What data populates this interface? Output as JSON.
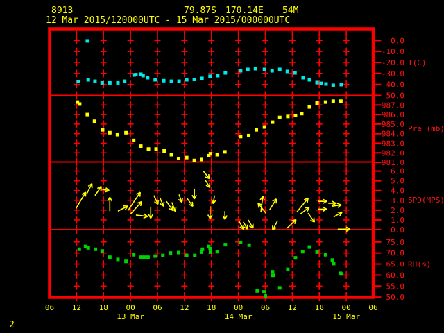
{
  "header": {
    "station_id": "8913",
    "lat": "79.87S",
    "lon": "170.14E",
    "elevation": "54M",
    "period": "12 Mar 2015/120000UTC - 15 Mar 2015/000000UTC"
  },
  "footer": {
    "corner_label": "2"
  },
  "colors": {
    "frame": "#ff0000",
    "axis_text": "#ff1414",
    "time_text": "#ffff00",
    "temp": "#00eaea",
    "pressure": "#ffff00",
    "wind": "#ffff00",
    "rh": "#00d400"
  },
  "x_axis": {
    "hours_span": 72,
    "tick_interval_hours": 6,
    "hour_labels": [
      "06",
      "12",
      "18",
      "00",
      "06",
      "12",
      "18",
      "00",
      "06",
      "12",
      "18",
      "00",
      "06"
    ],
    "date_labels": [
      {
        "label": "13 Mar",
        "col": 3
      },
      {
        "label": "14 Mar",
        "col": 7
      },
      {
        "label": "15 Mar",
        "col": 11
      }
    ]
  },
  "chart_data": [
    {
      "type": "scatter",
      "name": "temperature",
      "unit_label": "T(C)",
      "color_key": "temp",
      "ylim": {
        "top": 10.6,
        "bottom": -50.0
      },
      "yticks": [
        {
          "v": 0,
          "label": "0.0"
        },
        {
          "v": -10,
          "label": "-10.0"
        },
        {
          "v": -20,
          "label": "-20.0"
        },
        {
          "v": -30,
          "label": "-30.0"
        },
        {
          "v": -40,
          "label": "-40.0"
        },
        {
          "v": -50,
          "label": "-50.0"
        }
      ],
      "points": [
        {
          "t": 6.4,
          "v": -37.4
        },
        {
          "t": 8.4,
          "v": -0.4
        },
        {
          "t": 8.6,
          "v": -35.8
        },
        {
          "t": 10.1,
          "v": -37.1
        },
        {
          "t": 11.7,
          "v": -38.6
        },
        {
          "t": 13.4,
          "v": -38.6
        },
        {
          "t": 15.2,
          "v": -38.6
        },
        {
          "t": 16.7,
          "v": -37.1
        },
        {
          "t": 18.8,
          "v": -31.4
        },
        {
          "t": 19.2,
          "v": -31.1
        },
        {
          "t": 20.3,
          "v": -30.7
        },
        {
          "t": 20.8,
          "v": -32.0
        },
        {
          "t": 21.8,
          "v": -33.9
        },
        {
          "t": 23.5,
          "v": -35.8
        },
        {
          "t": 25.4,
          "v": -36.6
        },
        {
          "t": 27.1,
          "v": -37.1
        },
        {
          "t": 28.8,
          "v": -37.1
        },
        {
          "t": 30.5,
          "v": -35.8
        },
        {
          "t": 32.2,
          "v": -35.5
        },
        {
          "t": 33.9,
          "v": -34.5
        },
        {
          "t": 35.7,
          "v": -32.6
        },
        {
          "t": 37.4,
          "v": -32.0
        },
        {
          "t": 39.1,
          "v": -29.5
        },
        {
          "t": 42.5,
          "v": -27.6
        },
        {
          "t": 44.1,
          "v": -26.3
        },
        {
          "t": 45.8,
          "v": -25.7
        },
        {
          "t": 47.8,
          "v": -26.3
        },
        {
          "t": 49.5,
          "v": -27.6
        },
        {
          "t": 51.2,
          "v": -26.3
        },
        {
          "t": 52.9,
          "v": -28.2
        },
        {
          "t": 54.6,
          "v": -29.5
        },
        {
          "t": 56.4,
          "v": -33.9
        },
        {
          "t": 57.8,
          "v": -35.8
        },
        {
          "t": 59.5,
          "v": -38.3
        },
        {
          "t": 60.4,
          "v": -39.0
        },
        {
          "t": 61.5,
          "v": -39.6
        },
        {
          "t": 63.1,
          "v": -40.8
        },
        {
          "t": 64.9,
          "v": -40.2
        }
      ]
    },
    {
      "type": "scatter",
      "name": "pressure",
      "unit_label": "Pre (mb)",
      "color_key": "pressure",
      "ylim": {
        "top": 988.0,
        "bottom": 981.04
      },
      "yticks": [
        {
          "v": 987,
          "label": "987.0"
        },
        {
          "v": 986,
          "label": "986.0"
        },
        {
          "v": 985,
          "label": "985.0"
        },
        {
          "v": 984,
          "label": "984.0"
        },
        {
          "v": 983,
          "label": "983.0"
        },
        {
          "v": 982,
          "label": "982.0"
        },
        {
          "v": 981,
          "label": "981.0"
        }
      ],
      "points": [
        {
          "t": 6.2,
          "v": 987.3
        },
        {
          "t": 6.7,
          "v": 987.1
        },
        {
          "t": 8.4,
          "v": 986.0
        },
        {
          "t": 10.0,
          "v": 985.3
        },
        {
          "t": 11.8,
          "v": 984.4
        },
        {
          "t": 13.4,
          "v": 984.1
        },
        {
          "t": 15.1,
          "v": 983.9
        },
        {
          "t": 17.0,
          "v": 984.1
        },
        {
          "t": 18.7,
          "v": 983.3
        },
        {
          "t": 20.3,
          "v": 982.7
        },
        {
          "t": 22.0,
          "v": 982.4
        },
        {
          "t": 23.7,
          "v": 982.4
        },
        {
          "t": 25.5,
          "v": 982.2
        },
        {
          "t": 27.1,
          "v": 981.8
        },
        {
          "t": 28.7,
          "v": 981.4
        },
        {
          "t": 30.5,
          "v": 981.5
        },
        {
          "t": 32.2,
          "v": 981.2
        },
        {
          "t": 33.8,
          "v": 981.3
        },
        {
          "t": 35.4,
          "v": 981.7
        },
        {
          "t": 35.8,
          "v": 981.9
        },
        {
          "t": 37.3,
          "v": 981.8
        },
        {
          "t": 39.0,
          "v": 982.1
        },
        {
          "t": 42.5,
          "v": 983.7
        },
        {
          "t": 44.3,
          "v": 983.8
        },
        {
          "t": 46.0,
          "v": 984.4
        },
        {
          "t": 47.8,
          "v": 984.7
        },
        {
          "t": 49.6,
          "v": 985.2
        },
        {
          "t": 51.2,
          "v": 985.7
        },
        {
          "t": 53.0,
          "v": 985.8
        },
        {
          "t": 54.7,
          "v": 985.9
        },
        {
          "t": 56.1,
          "v": 986.1
        },
        {
          "t": 57.8,
          "v": 986.8
        },
        {
          "t": 59.5,
          "v": 987.2
        },
        {
          "t": 61.4,
          "v": 987.3
        },
        {
          "t": 63.1,
          "v": 987.4
        },
        {
          "t": 64.8,
          "v": 987.4
        }
      ]
    },
    {
      "type": "wind-vectors",
      "name": "wind-speed-direction",
      "unit_label": "SPD(MPS)",
      "color_key": "wind",
      "ylim": {
        "top": 6.93,
        "bottom": 0
      },
      "yticks": [
        {
          "v": 6,
          "label": "6.0"
        },
        {
          "v": 5,
          "label": "5.0"
        },
        {
          "v": 4,
          "label": "4.0"
        },
        {
          "v": 3,
          "label": "3.0"
        },
        {
          "v": 2,
          "label": "2.0"
        },
        {
          "v": 1,
          "label": "1.0"
        },
        {
          "v": 0,
          "label": "0.0"
        }
      ],
      "arrows": [
        {
          "t": 5.9,
          "spd": 2.2,
          "dir": 31,
          "len": 27
        },
        {
          "t": 8.3,
          "spd": 3.7,
          "dir": 27,
          "len": 16
        },
        {
          "t": 10.1,
          "spd": 3.5,
          "dir": 35,
          "len": 16
        },
        {
          "t": 11.0,
          "spd": 4.2,
          "dir": 101,
          "len": 15
        },
        {
          "t": 13.4,
          "spd": 1.9,
          "dir": 0,
          "len": 20
        },
        {
          "t": 15.2,
          "spd": 1.9,
          "dir": 63,
          "len": 16
        },
        {
          "t": 17.5,
          "spd": 2.0,
          "dir": 34,
          "len": 31
        },
        {
          "t": 18.0,
          "spd": 1.6,
          "dir": 42,
          "len": 24
        },
        {
          "t": 19.2,
          "spd": 1.5,
          "dir": 97,
          "len": 17
        },
        {
          "t": 22.5,
          "spd": 2.3,
          "dir": 180,
          "len": 16
        },
        {
          "t": 23.2,
          "spd": 3.5,
          "dir": 155,
          "len": 14
        },
        {
          "t": 24.5,
          "spd": 3.3,
          "dir": 156,
          "len": 14
        },
        {
          "t": 26.0,
          "spd": 2.9,
          "dir": 145,
          "len": 16
        },
        {
          "t": 27.2,
          "spd": 2.8,
          "dir": 159,
          "len": 14
        },
        {
          "t": 28.8,
          "spd": 3.6,
          "dir": 160,
          "len": 12
        },
        {
          "t": 30.6,
          "spd": 3.2,
          "dir": 144,
          "len": 14
        },
        {
          "t": 32.2,
          "spd": 4.2,
          "dir": 180,
          "len": 15
        },
        {
          "t": 34.2,
          "spd": 6.0,
          "dir": 141,
          "len": 14
        },
        {
          "t": 34.6,
          "spd": 5.1,
          "dir": 148,
          "len": 13
        },
        {
          "t": 35.7,
          "spd": 2.4,
          "dir": 180,
          "len": 18
        },
        {
          "t": 36.7,
          "spd": 3.5,
          "dir": 190,
          "len": 12
        },
        {
          "t": 39.0,
          "spd": 1.9,
          "dir": 180,
          "len": 12
        },
        {
          "t": 42.1,
          "spd": 0.9,
          "dir": 150,
          "len": 14
        },
        {
          "t": 43.1,
          "spd": 0.8,
          "dir": 151,
          "len": 12
        },
        {
          "t": 44.2,
          "spd": 1.0,
          "dir": 150,
          "len": 14
        },
        {
          "t": 47.0,
          "spd": 1.8,
          "dir": 7,
          "len": 23
        },
        {
          "t": 48.1,
          "spd": 1.7,
          "dir": 322,
          "len": 18
        },
        {
          "t": 48.9,
          "spd": 2.0,
          "dir": 32,
          "len": 19
        },
        {
          "t": 50.7,
          "spd": 0.9,
          "dir": 208,
          "len": 15
        },
        {
          "t": 52.7,
          "spd": 0.1,
          "dir": 47,
          "len": 19
        },
        {
          "t": 55.0,
          "spd": 1.8,
          "dir": 39,
          "len": 26
        },
        {
          "t": 55.8,
          "spd": 1.6,
          "dir": 52,
          "len": 16
        },
        {
          "t": 57.5,
          "spd": 1.7,
          "dir": 145,
          "len": 16
        },
        {
          "t": 59.8,
          "spd": 2.9,
          "dir": 90,
          "len": 12
        },
        {
          "t": 59.8,
          "spd": 2.1,
          "dir": 90,
          "len": 12
        },
        {
          "t": 62.0,
          "spd": 2.7,
          "dir": 90,
          "len": 11
        },
        {
          "t": 62.9,
          "spd": 2.4,
          "dir": 81,
          "len": 13
        },
        {
          "t": 63.2,
          "spd": 1.3,
          "dir": 60,
          "len": 14
        },
        {
          "t": 64.1,
          "spd": 0.05,
          "dir": 90,
          "len": 18
        }
      ]
    },
    {
      "type": "scatter",
      "name": "relative-humidity",
      "unit_label": "RH(%)",
      "color_key": "rh",
      "ylim": {
        "top": 80.6,
        "bottom": 49.9
      },
      "yticks": [
        {
          "v": 75,
          "label": "75.0"
        },
        {
          "v": 70,
          "label": "70.0"
        },
        {
          "v": 65,
          "label": "65.0"
        },
        {
          "v": 60,
          "label": "60.0"
        },
        {
          "v": 55,
          "label": "55.0"
        },
        {
          "v": 50,
          "label": "50.0"
        }
      ],
      "points": [
        {
          "t": 6.6,
          "v": 71.7
        },
        {
          "t": 8.0,
          "v": 73.0
        },
        {
          "t": 8.6,
          "v": 72.3
        },
        {
          "t": 10.2,
          "v": 71.7
        },
        {
          "t": 11.7,
          "v": 70.9
        },
        {
          "t": 13.4,
          "v": 68.1
        },
        {
          "t": 15.2,
          "v": 67.1
        },
        {
          "t": 17.0,
          "v": 66.2
        },
        {
          "t": 18.7,
          "v": 69.2
        },
        {
          "t": 20.3,
          "v": 68.1
        },
        {
          "t": 21.0,
          "v": 68.1
        },
        {
          "t": 21.9,
          "v": 68.1
        },
        {
          "t": 23.5,
          "v": 68.6
        },
        {
          "t": 25.2,
          "v": 68.9
        },
        {
          "t": 26.9,
          "v": 70.0
        },
        {
          "t": 28.7,
          "v": 70.2
        },
        {
          "t": 30.5,
          "v": 68.9
        },
        {
          "t": 32.3,
          "v": 68.9
        },
        {
          "t": 33.8,
          "v": 70.4
        },
        {
          "t": 34.0,
          "v": 71.7
        },
        {
          "t": 35.4,
          "v": 73.0
        },
        {
          "t": 35.7,
          "v": 72.0
        },
        {
          "t": 35.8,
          "v": 70.4
        },
        {
          "t": 37.3,
          "v": 70.6
        },
        {
          "t": 39.1,
          "v": 73.8
        },
        {
          "t": 42.5,
          "v": 74.8
        },
        {
          "t": 44.4,
          "v": 73.6
        },
        {
          "t": 46.2,
          "v": 52.8
        },
        {
          "t": 47.7,
          "v": 52.4
        },
        {
          "t": 48.0,
          "v": 50.5
        },
        {
          "t": 49.6,
          "v": 61.5
        },
        {
          "t": 49.7,
          "v": 59.9
        },
        {
          "t": 51.2,
          "v": 54.2
        },
        {
          "t": 53.0,
          "v": 62.6
        },
        {
          "t": 54.7,
          "v": 67.8
        },
        {
          "t": 56.3,
          "v": 70.6
        },
        {
          "t": 57.8,
          "v": 72.7
        },
        {
          "t": 59.5,
          "v": 70.4
        },
        {
          "t": 61.4,
          "v": 69.2
        },
        {
          "t": 62.9,
          "v": 66.8
        },
        {
          "t": 63.2,
          "v": 65.2
        },
        {
          "t": 64.7,
          "v": 60.8
        },
        {
          "t": 65.0,
          "v": 60.5
        }
      ]
    }
  ]
}
